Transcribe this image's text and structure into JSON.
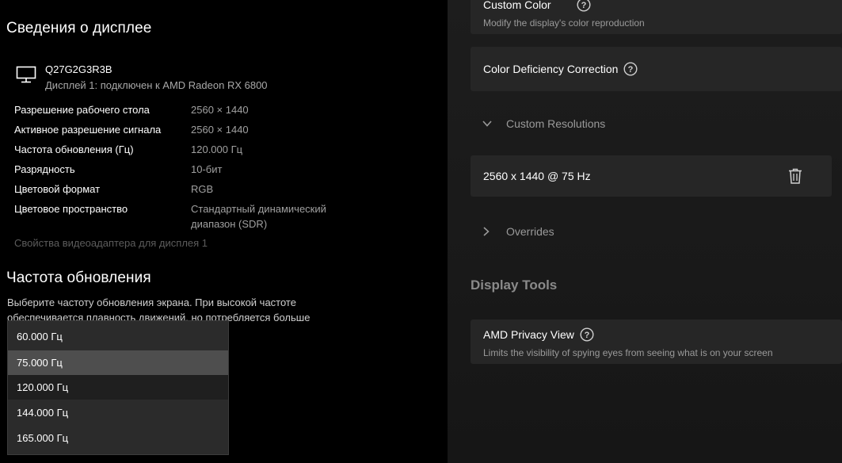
{
  "display_info": {
    "title": "Сведения о дисплее",
    "monitor_name": "Q27G2G3R3B",
    "monitor_sub": "Дисплей 1: подключен к AMD Radeon RX 6800",
    "properties": [
      {
        "label": "Разрешение рабочего стола",
        "value": "2560 × 1440"
      },
      {
        "label": "Активное разрешение сигнала",
        "value": "2560 × 1440"
      },
      {
        "label": "Частота обновления (Гц)",
        "value": "120.000 Гц"
      },
      {
        "label": "Разрядность",
        "value": "10-бит"
      },
      {
        "label": "Цветовой формат",
        "value": "RGB"
      },
      {
        "label": "Цветовое пространство",
        "value": "Стандартный динамический диапазон (SDR)"
      }
    ],
    "adapter_link": "Свойства видеоадаптера для дисплея 1"
  },
  "refresh": {
    "title": "Частота обновления",
    "description": "Выберите частоту обновления экрана. При высокой частоте обеспечивается плавность движений. но потребляется больше",
    "options": [
      {
        "label": "60.000 Гц"
      },
      {
        "label": "75.000 Гц"
      },
      {
        "label": "120.000 Гц"
      },
      {
        "label": "144.000 Гц"
      },
      {
        "label": "165.000 Гц"
      }
    ],
    "highlighted": "75.000 Гц",
    "current": "120.000 Гц"
  },
  "amd": {
    "custom_color": {
      "title": "Custom Color",
      "subtitle": "Modify the display's color reproduction"
    },
    "color_deficiency": {
      "title": "Color Deficiency Correction"
    },
    "custom_resolutions": {
      "label": "Custom Resolutions",
      "expanded": true
    },
    "resolution_entry": {
      "label": "2560 x 1440 @ 75 Hz"
    },
    "overrides": {
      "label": "Overrides",
      "expanded": false
    },
    "display_tools_heading": "Display Tools",
    "privacy_view": {
      "title": "AMD Privacy View",
      "subtitle": "Limits the visibility of spying eyes from seeing what is on your screen"
    }
  },
  "icons": {
    "monitor": "monitor-icon",
    "help": "help-circle-icon",
    "chevron_down": "chevron-down-icon",
    "chevron_right": "chevron-right-icon",
    "trash": "trash-icon"
  }
}
